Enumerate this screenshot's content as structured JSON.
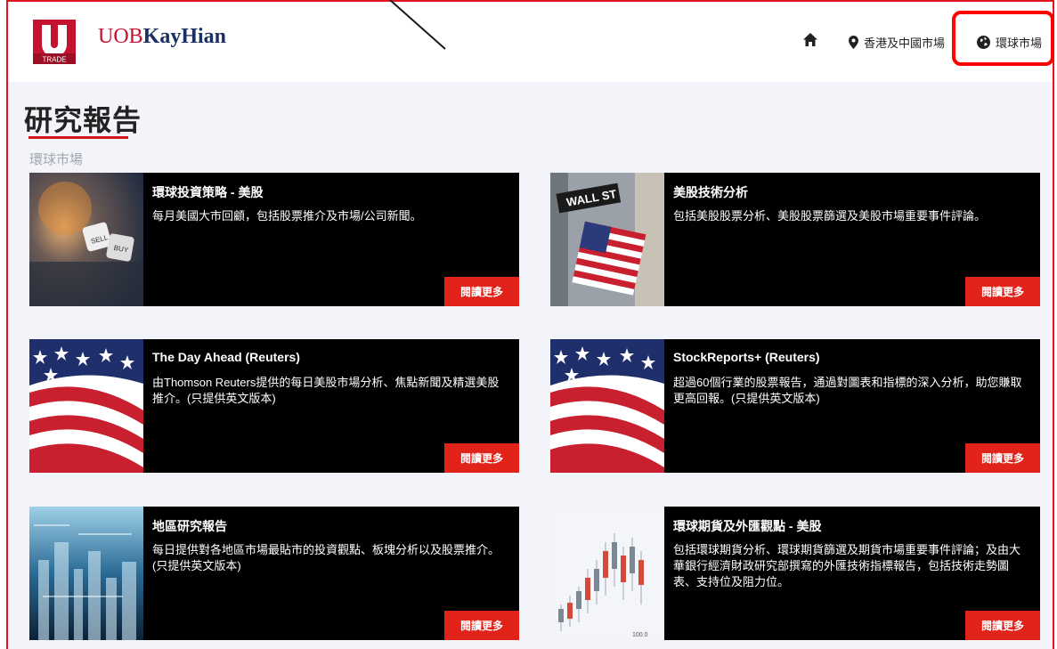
{
  "header": {
    "logo_text": "TRADE",
    "brand_prefix": "UOB",
    "brand_suffix": "KayHian",
    "nav": {
      "hk_china": "香港及中國市場",
      "global": "環球市場"
    }
  },
  "page": {
    "title": "研究報告",
    "section": "環球市場"
  },
  "cards": [
    {
      "title": "環球投資策略 - 美股",
      "desc": "每月美國大市回顧，包括股票推介及市場/公司新聞。",
      "button": "閱讀更多",
      "thumb_text": [
        "SELL",
        "BUY"
      ]
    },
    {
      "title": "美股技術分析",
      "desc": "包括美股股票分析、美股股票篩選及美股市場重要事件評論。",
      "button": "閱讀更多",
      "thumb_text": [
        "WALL ST"
      ]
    },
    {
      "title": "The Day Ahead (Reuters)",
      "desc": "由Thomson Reuters提供的每日美股市場分析、焦點新聞及精選美股推介。(只提供英文版本)",
      "button": "閱讀更多"
    },
    {
      "title": "StockReports+ (Reuters)",
      "desc": "超過60個行業的股票報告，通過對圖表和指標的深入分析，助您賺取更高回報。(只提供英文版本)",
      "button": "閱讀更多"
    },
    {
      "title": "地區研究報告",
      "desc": "每日提供對各地區市場最貼市的投資觀點、板塊分析以及股票推介。(只提供英文版本)",
      "button": "閱讀更多"
    },
    {
      "title": "環球期貨及外匯觀點 - 美股",
      "desc": "包括環球期貨分析、環球期貨篩選及期貨市場重要事件評論；及由大華銀行經濟財政研究部撰寫的外匯技術指標報告，包括技術走勢圖表、支持位及阻力位。",
      "button": "閱讀更多",
      "thumb_text": [
        "100.0"
      ]
    }
  ],
  "colors": {
    "accent": "#e2231a",
    "brand_red": "#c41230",
    "brand_navy": "#1b2f60",
    "highlight_box": "#ff0000"
  }
}
